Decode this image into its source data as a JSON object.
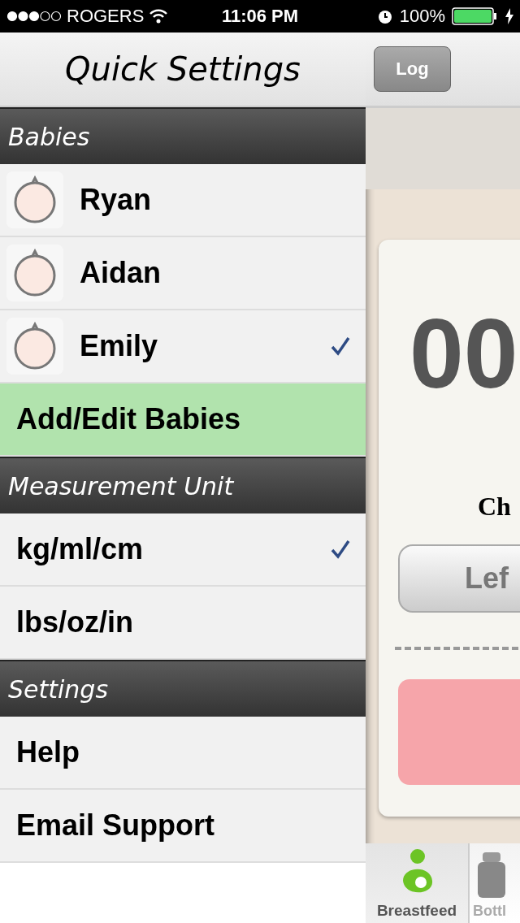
{
  "status_bar": {
    "carrier": "ROGERS",
    "time": "11:06 PM",
    "battery": "100%"
  },
  "sidebar": {
    "title": "Quick Settings",
    "sections": [
      {
        "title": "Babies",
        "items": [
          {
            "kind": "baby",
            "label": "Ryan",
            "selected": false
          },
          {
            "kind": "baby",
            "label": "Aidan",
            "selected": false
          },
          {
            "kind": "baby",
            "label": "Emily",
            "selected": true
          },
          {
            "kind": "action",
            "label": "Add/Edit Babies"
          }
        ]
      },
      {
        "title": "Measurement Unit",
        "items": [
          {
            "kind": "option",
            "label": "kg/ml/cm",
            "selected": true
          },
          {
            "kind": "option",
            "label": "lbs/oz/in",
            "selected": false
          }
        ]
      },
      {
        "title": "Settings",
        "items": [
          {
            "kind": "link",
            "label": "Help"
          },
          {
            "kind": "link",
            "label": "Email Support"
          }
        ]
      }
    ]
  },
  "main": {
    "log_button": "Log",
    "timer": "00",
    "caption": "Ch",
    "side_button": "Lef",
    "tabs": [
      {
        "label": "Breastfeed",
        "selected": true
      },
      {
        "label": "Bottl",
        "selected": false
      }
    ]
  }
}
